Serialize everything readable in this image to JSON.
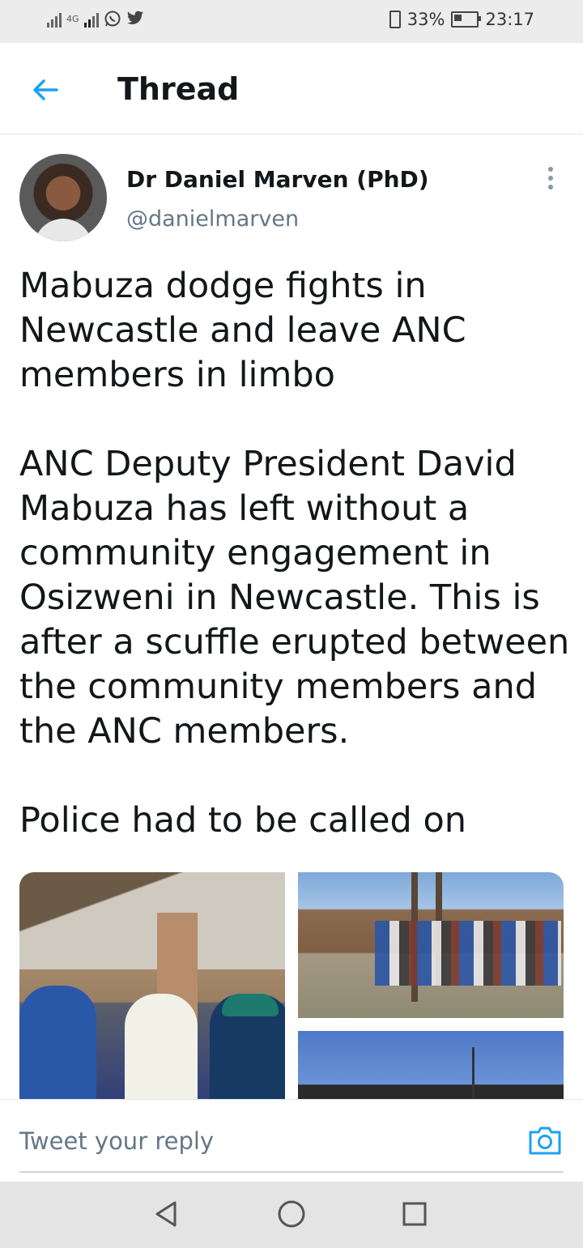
{
  "status_bar": {
    "network": "4G",
    "battery_percent": "33%",
    "time": "23:17",
    "icons": [
      "signal-icon",
      "signal-4g-icon",
      "whatsapp-icon",
      "twitter-icon",
      "vibrate-icon",
      "battery-icon"
    ]
  },
  "header": {
    "title": "Thread",
    "back_icon": "arrow-left-icon"
  },
  "tweet": {
    "author_name": "Dr Daniel Marven (PhD)",
    "author_handle": "@danielmarven",
    "text": "Mabuza dodge fights in Newcastle and leave ANC members in limbo\n\nANC Deputy President David Mabuza has left without a community engagement in Osizweni in Newcastle. This is after a scuffle erupted between the community members and the ANC members.\n\nPolice had to be called on",
    "media_count": 3
  },
  "reply": {
    "placeholder": "Tweet your reply",
    "camera_icon": "camera-icon"
  },
  "colors": {
    "accent": "#1da1f2",
    "text": "#14171a",
    "muted": "#657786"
  }
}
